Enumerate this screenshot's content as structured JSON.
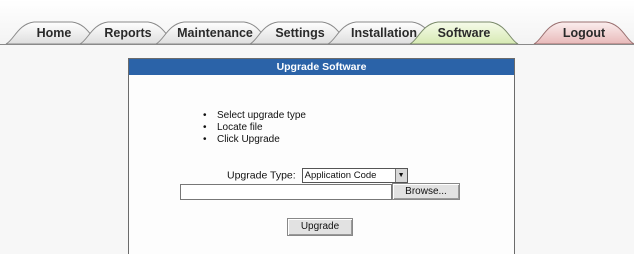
{
  "nav": {
    "tabs": [
      {
        "label": "Home"
      },
      {
        "label": "Reports"
      },
      {
        "label": "Maintenance"
      },
      {
        "label": "Settings"
      },
      {
        "label": "Installation"
      },
      {
        "label": "Software"
      }
    ],
    "active_tab": "Software",
    "logout_label": "Logout"
  },
  "dialog": {
    "title": "Upgrade Software",
    "steps": [
      "Select upgrade type",
      "Locate file",
      "Click Upgrade"
    ],
    "bullet": "•",
    "upgrade_type_label": "Upgrade Type:",
    "upgrade_type_value": "Application Code",
    "file_value": "",
    "browse_label": "Browse...",
    "upgrade_label": "Upgrade"
  },
  "colors": {
    "title_bar": "#2b63a8",
    "active_tab": "#e6f3cf",
    "logout_tab": "#f2d3d3",
    "tab": "#ececec"
  }
}
